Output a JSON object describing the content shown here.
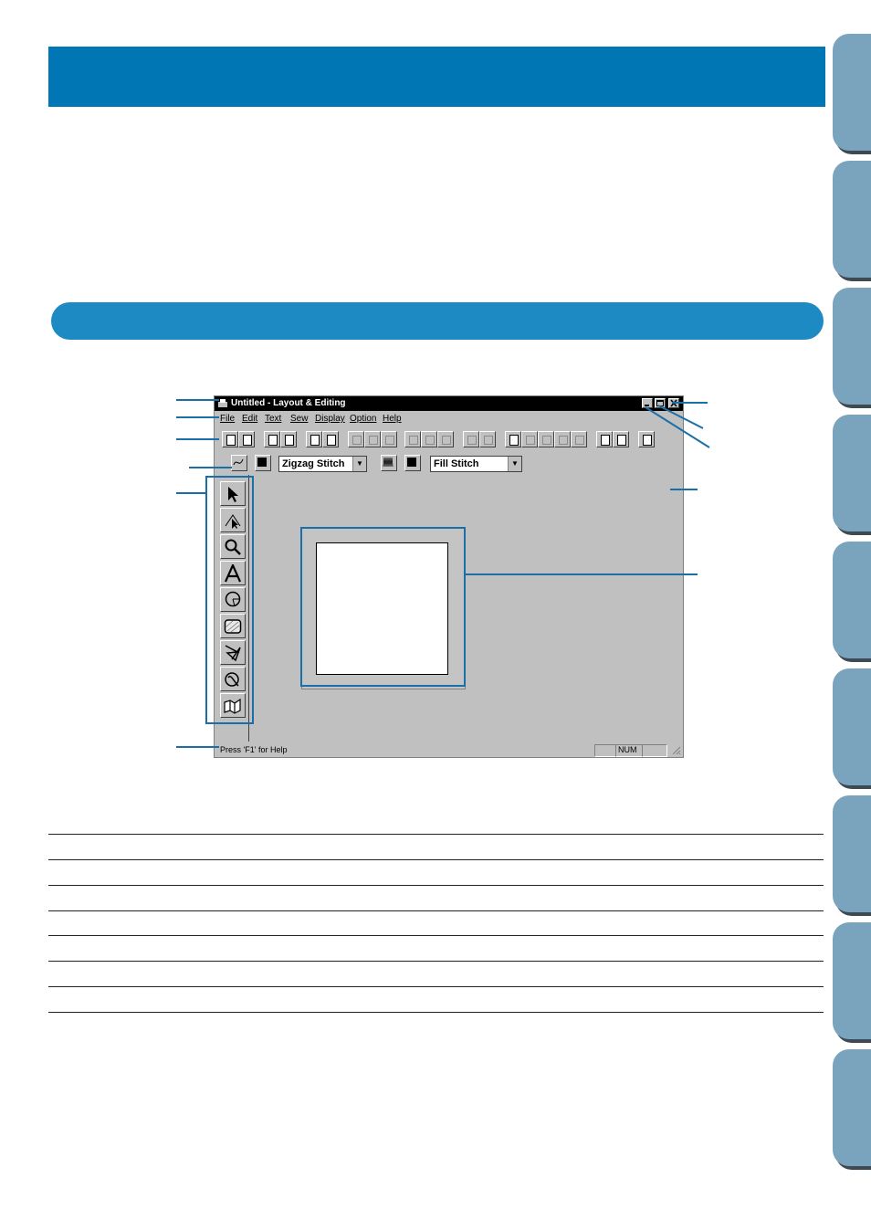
{
  "window": {
    "title": "Untitled - Layout & Editing",
    "menu": [
      "File",
      "Edit",
      "Text",
      "Sew",
      "Display",
      "Option",
      "Help"
    ],
    "stitch_bar": {
      "line_stitch": "Zigzag Stitch",
      "region_stitch": "Fill Stitch"
    },
    "status": {
      "help_text": "Press 'F1' for Help",
      "num": "NUM"
    },
    "tools": [
      "select-icon",
      "point-edit-icon",
      "zoom-icon",
      "text-icon",
      "circle-arc-icon",
      "rectangle-icon",
      "outline-icon",
      "manual-punch-icon",
      "stitch-icon"
    ]
  },
  "colors": {
    "header_band": "#0077b4",
    "section_bar": "#1e8ac3",
    "side_tab": "#7aa3bd",
    "leader_line": "#1b6fa8"
  }
}
